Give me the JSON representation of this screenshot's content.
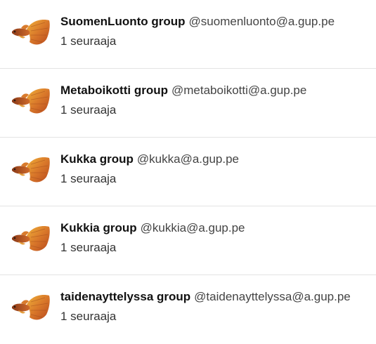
{
  "groups": [
    {
      "name": "SuomenLuonto group",
      "handle": "@suomenluonto@a.gup.pe",
      "followers": "1 seuraaja",
      "avatar_icon": "guppy-fish-icon"
    },
    {
      "name": "Metaboikotti group",
      "handle": "@metaboikotti@a.gup.pe",
      "followers": "1 seuraaja",
      "avatar_icon": "guppy-fish-icon"
    },
    {
      "name": "Kukka group",
      "handle": "@kukka@a.gup.pe",
      "followers": "1 seuraaja",
      "avatar_icon": "guppy-fish-icon"
    },
    {
      "name": "Kukkia group",
      "handle": "@kukkia@a.gup.pe",
      "followers": "1 seuraaja",
      "avatar_icon": "guppy-fish-icon"
    },
    {
      "name": "taidenayttelyssa group",
      "handle": "@taidenayttelyssa@a.gup.pe",
      "followers": "1 seuraaja",
      "avatar_icon": "guppy-fish-icon"
    }
  ],
  "colors": {
    "fish_body": "#c8652a",
    "fish_tail": "#e0a032",
    "fish_dark": "#8a3a18",
    "divider": "#e3e3e3"
  }
}
